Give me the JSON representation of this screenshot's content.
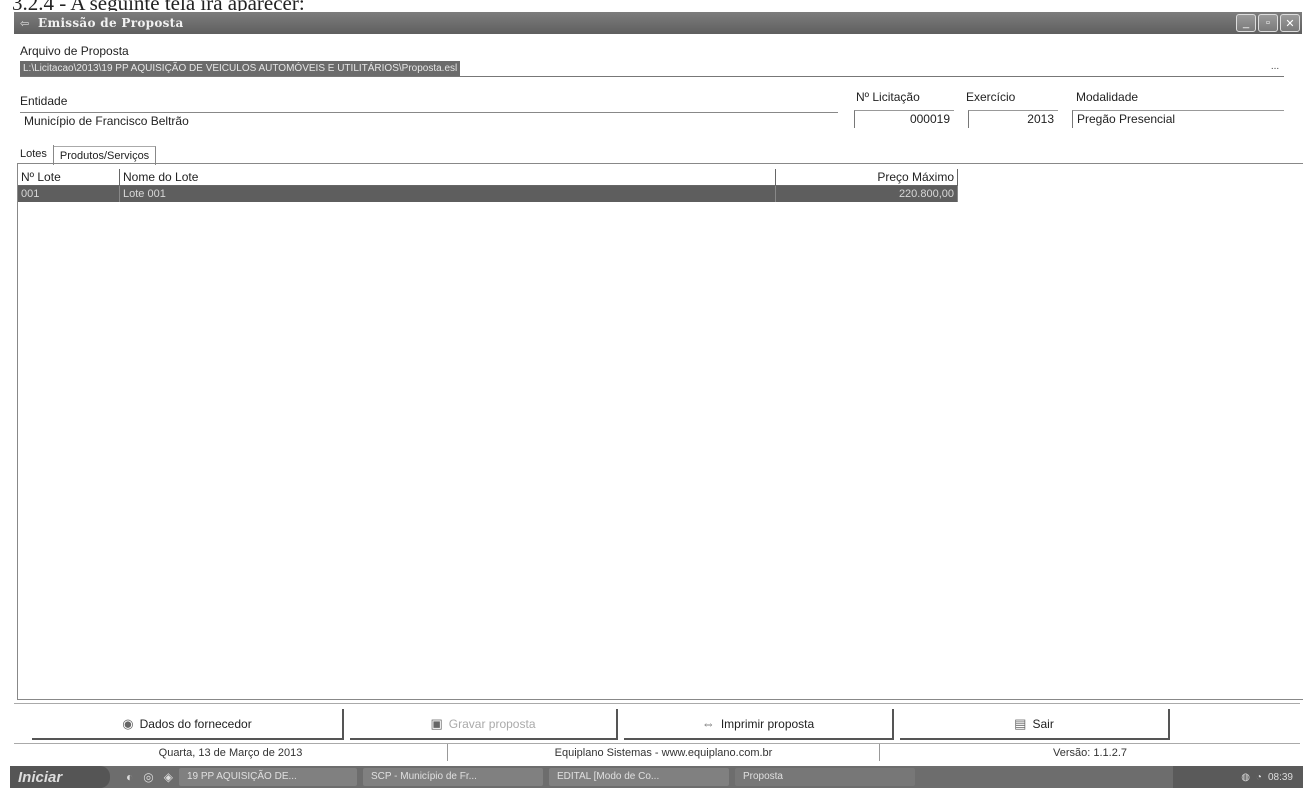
{
  "document": {
    "heading": "3.2.4 - A seguinte tela irá aparecer:"
  },
  "window": {
    "title": "Emissão de Proposta",
    "controls": {
      "minimize": "_",
      "maximize": "▫",
      "close": "✕"
    }
  },
  "form": {
    "file_label": "Arquivo de Proposta",
    "file_path": "L:\\Licitacao\\2013\\19 PP AQUISIÇÃO DE VEICULOS AUTOMÓVEIS E UTILITÁRIOS\\Proposta.esl",
    "browse_label": "...",
    "entity_label": "Entidade",
    "entity_value": "Município de Francisco Beltrão",
    "bid_no_label": "Nº Licitação",
    "bid_no_value": "000019",
    "year_label": "Exercício",
    "year_value": "2013",
    "modality_label": "Modalidade",
    "modality_value": "Pregão Presencial"
  },
  "tabs": [
    {
      "label": "Lotes",
      "active": true
    },
    {
      "label": "Produtos/Serviços",
      "active": false
    }
  ],
  "table": {
    "columns": [
      "Nº Lote",
      "Nome do Lote",
      "Preço Máximo"
    ],
    "rows": [
      {
        "lote": "001",
        "nome": "Lote 001",
        "preco": "220.800,00",
        "selected": true
      }
    ]
  },
  "buttons": {
    "supplier": "Dados do fornecedor",
    "save": "Gravar proposta",
    "print": "Imprimir proposta",
    "exit": "Sair"
  },
  "status": {
    "date": "Quarta, 13 de Março de 2013",
    "company": "Equiplano Sistemas - www.equiplano.com.br",
    "version": "Versão: 1.1.2.7"
  },
  "taskbar": {
    "start": "Iniciar",
    "tasks": [
      "19 PP AQUISIÇÃO DE...",
      "SCP - Município de Fr...",
      "EDITAL [Modo de Co...",
      "Proposta"
    ],
    "clock": "08:39"
  },
  "colors": {
    "titlebar": "#6b6b6b",
    "selection": "#5e5e5e",
    "taskbar": "#6d6d6d"
  }
}
